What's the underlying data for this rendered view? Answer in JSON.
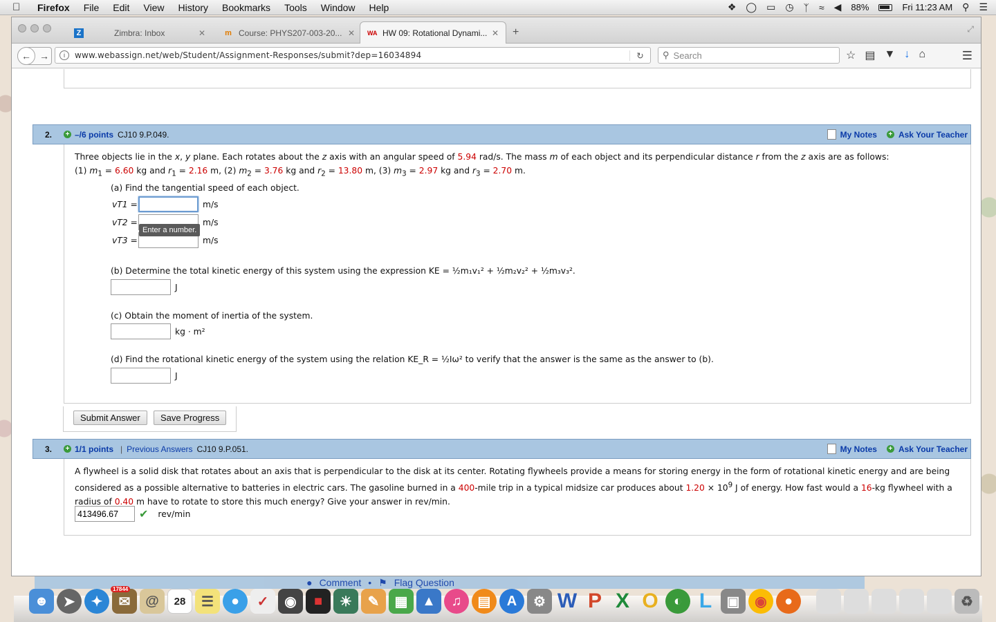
{
  "menubar": {
    "app_name": "Firefox",
    "menus": [
      "File",
      "Edit",
      "View",
      "History",
      "Bookmarks",
      "Tools",
      "Window",
      "Help"
    ],
    "battery": "88%",
    "clock": "Fri 11:23 AM"
  },
  "tabs": [
    {
      "favicon": "Z",
      "title": "Zimbra: Inbox"
    },
    {
      "favicon": "m",
      "title": "Course: PHYS207-003-20..."
    },
    {
      "favicon": "WA",
      "title": "HW 09: Rotational Dynami..."
    }
  ],
  "navbar": {
    "url": "www.webassign.net/web/Student/Assignment-Responses/submit?dep=16034894",
    "search_placeholder": "Search"
  },
  "q2": {
    "number": "2.",
    "points": "–/6 points",
    "code": "CJ10 9.P.049.",
    "my_notes": "My Notes",
    "ask_teacher": "Ask Your Teacher",
    "intro_a": "Three objects lie in the ",
    "omega": "5.94",
    "m1": "6.60",
    "r1": "2.16",
    "m2": "3.76",
    "r2": "13.80",
    "m3": "2.97",
    "r3": "2.70",
    "part_a": "(a) Find the tangential speed of each object.",
    "labels": [
      "vT1 =",
      "vT2 =",
      "vT3 ="
    ],
    "unit_speed": "m/s",
    "tooltip": "Enter a number.",
    "part_b": "(b) Determine the total kinetic energy of this system using the expression KE = ½m₁v₁² + ½m₂v₂² + ½m₃v₃².",
    "unit_energy": "J",
    "part_c": "(c) Obtain the moment of inertia of the system.",
    "unit_inertia": "kg · m²",
    "part_d": "(d) Find the rotational kinetic energy of the system using the relation KE_R = ½Iω² to verify that the answer is the same as the answer to (b).",
    "submit": "Submit Answer",
    "save": "Save Progress"
  },
  "q3": {
    "number": "3.",
    "points": "1/1 points",
    "prev_answers": "Previous Answers",
    "code": "CJ10 9.P.051.",
    "my_notes": "My Notes",
    "ask_teacher": "Ask Your Teacher",
    "miles": "400",
    "energy": "1.20",
    "mass": "16",
    "radius": "0.40",
    "answer": "413496.67",
    "unit": "rev/min"
  },
  "footer": {
    "comment": "Comment",
    "flag": "Flag Question"
  },
  "dock_badge": "17844",
  "calendar_day": "28"
}
